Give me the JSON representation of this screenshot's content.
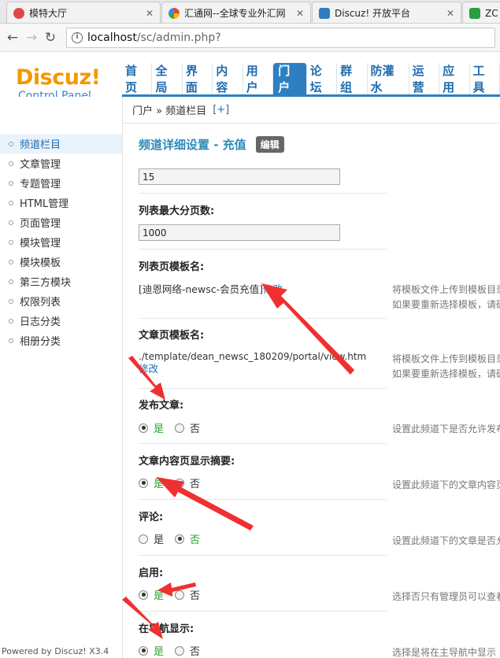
{
  "browser": {
    "tabs": [
      {
        "title": "模特大厅",
        "color": "#e0474c"
      },
      {
        "title": "汇通网--全球专业外汇网",
        "color": "#4285f4"
      },
      {
        "title": "Discuz! 开放平台",
        "color": "#2d7fc1"
      },
      {
        "title": "ZC",
        "color": "#2a9d3c"
      }
    ],
    "url_host": "localhost",
    "url_path": "/sc/admin.php?"
  },
  "logo": {
    "brand": "Discuz!",
    "subtitle": "Control Panel"
  },
  "nav": [
    "首页",
    "全局",
    "界面",
    "内容",
    "用户",
    "门户",
    "论坛",
    "群组",
    "防灌水",
    "运营",
    "应用",
    "工具"
  ],
  "nav_active": "门户",
  "breadcrumb": {
    "path": "门户 » 频道栏目",
    "add": "[+]"
  },
  "sidebar": {
    "items": [
      "频道栏目",
      "文章管理",
      "专题管理",
      "HTML管理",
      "页面管理",
      "模块管理",
      "模块模板",
      "第三方模块",
      "权限列表",
      "日志分类",
      "相册分类"
    ],
    "active": "频道栏目",
    "powered": "Powered by Discuz! X3.4"
  },
  "content": {
    "title": "频道详细设置 - 充值",
    "edit_badge": "编辑",
    "field_perpage_value": "15",
    "max_pages_label": "列表最大分页数:",
    "max_pages_value": "1000",
    "list_tpl_label": "列表页模板名:",
    "list_tpl_value": "[迪恩网络-newsc-会员充值]",
    "list_tpl_link": "修改",
    "list_tpl_help1": "将模板文件上传到模板目录",
    "list_tpl_help2": "如果要重新选择模板，请确",
    "article_tpl_label": "文章页模板名:",
    "article_tpl_value": "./template/dean_newsc_180209/portal/view.htm",
    "article_tpl_link": "修改",
    "article_tpl_help1": "将模板文件上传到模板目录",
    "article_tpl_help2": "如果要重新选择模板，请确",
    "yes": "是",
    "no": "否",
    "publish_label": "发布文章:",
    "publish_help": "设置此频道下是否允许发布",
    "summary_label": "文章内容页显示摘要:",
    "summary_help": "设置此频道下的文章内容页",
    "comment_label": "评论:",
    "comment_help": "设置此频道下的文章是否允",
    "enable_label": "启用:",
    "enable_help": "选择否只有管理员可以查看",
    "mainnav_label": "在导航显示:",
    "mainnav_help": "选择是将在主导航中显示"
  }
}
